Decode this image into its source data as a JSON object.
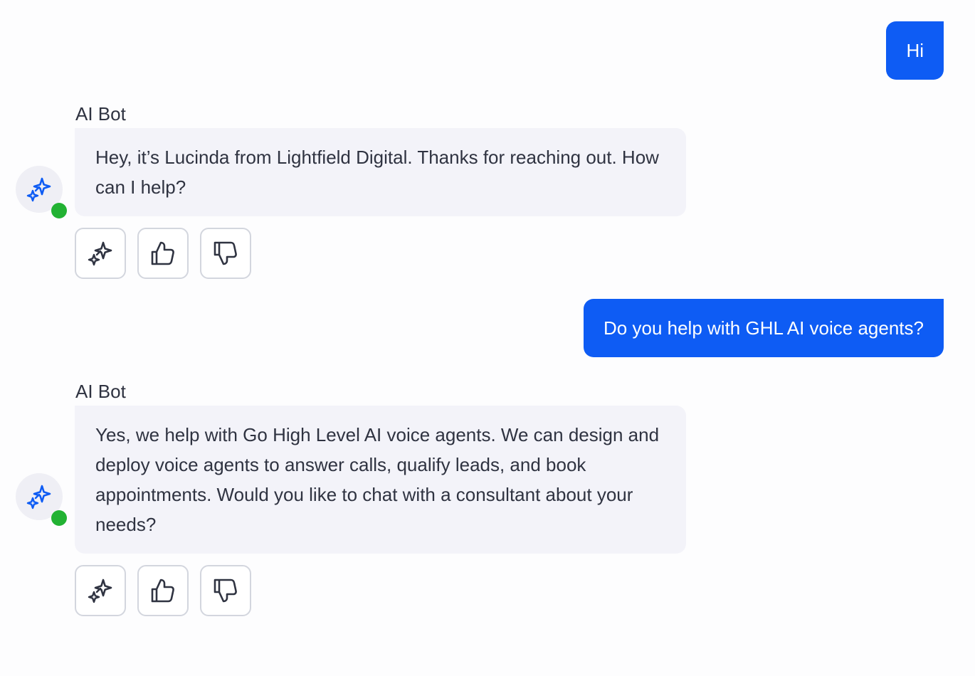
{
  "colors": {
    "user_bubble": "#0E5CF4",
    "bot_bubble": "#F3F3F9",
    "online_status": "#22B233",
    "bot_icon": "#0E5CF4",
    "action_icon": "#2F3341"
  },
  "messages": [
    {
      "role": "user",
      "text": "Hi"
    },
    {
      "role": "bot",
      "sender": "AI Bot",
      "text": "Hey, it’s Lucinda from Lightfield Digital. Thanks for reaching out. How can I help?",
      "avatar_icon": "sparkle-icon",
      "actions": [
        "sparkle-icon",
        "thumbs-up-icon",
        "thumbs-down-icon"
      ]
    },
    {
      "role": "user",
      "text": "Do you help with GHL AI voice agents?"
    },
    {
      "role": "bot",
      "sender": "AI Bot",
      "text": "Yes, we help with Go High Level AI voice agents. We can design and deploy voice agents to answer calls, qualify leads, and book appointments. Would you like to chat with a consultant about your needs?",
      "avatar_icon": "sparkle-icon",
      "actions": [
        "sparkle-icon",
        "thumbs-up-icon",
        "thumbs-down-icon"
      ]
    }
  ]
}
